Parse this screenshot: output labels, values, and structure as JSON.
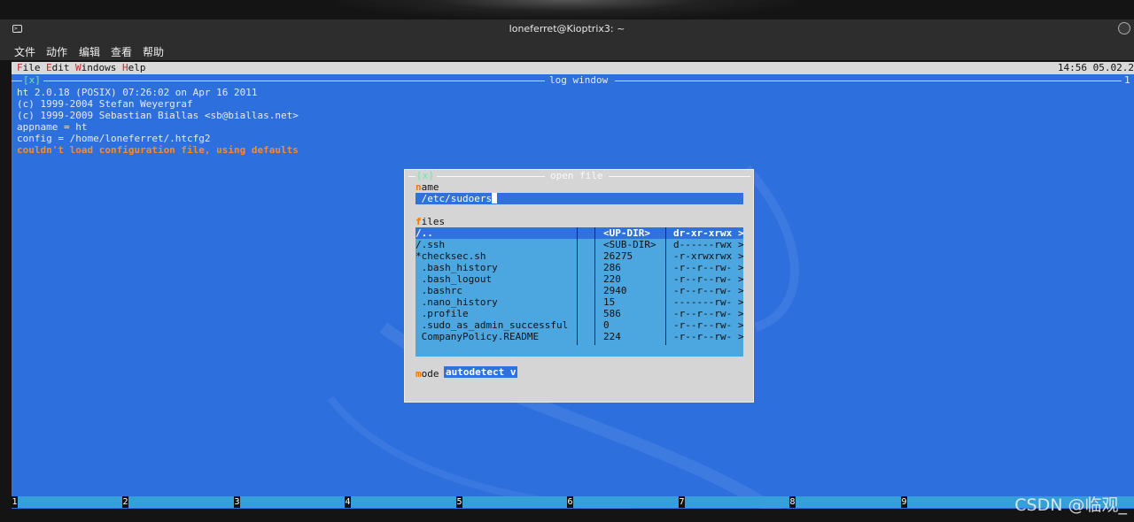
{
  "window": {
    "title": "loneferret@Kioptrix3: ~"
  },
  "app_menu": [
    "文件",
    "动作",
    "编辑",
    "查看",
    "帮助"
  ],
  "ht_menu": {
    "items": [
      {
        "hotkey": "F",
        "rest": "ile"
      },
      {
        "hotkey": "E",
        "rest": "dit"
      },
      {
        "hotkey": "W",
        "rest": "indows"
      },
      {
        "hotkey": "H",
        "rest": "elp"
      }
    ],
    "clock": "14:56 05.02.2"
  },
  "log_window": {
    "close_label": "[x]",
    "title": "log window",
    "number": "1",
    "lines": [
      "ht 2.0.18 (POSIX) 07:26:02 on Apr 16 2011",
      "(c) 1999-2004 Stefan Weyergraf",
      "(c) 1999-2009 Sebastian Biallas <sb@biallas.net>",
      "appname = ht",
      "config = /home/loneferret/.htcfg2"
    ],
    "warning": "couldn't load configuration file, using defaults"
  },
  "open_file": {
    "close_label": "[x]",
    "title": "open file",
    "name_label": {
      "hotkey": "n",
      "rest": "ame"
    },
    "name_value": " /etc/sudoers",
    "files_label": {
      "hotkey": "f",
      "rest": "iles"
    },
    "files": [
      {
        "name": "/..",
        "size": "<UP-DIR>",
        "perm": "dr-xr-xrwx",
        "more": ">"
      },
      {
        "name": "/.ssh",
        "size": "<SUB-DIR>",
        "perm": "d------rwx",
        "more": ">"
      },
      {
        "name": "*checksec.sh",
        "size": "26275",
        "perm": "-r-xrwxrwx",
        "more": ">"
      },
      {
        "name": " .bash_history",
        "size": "286",
        "perm": "-r--r--rw-",
        "more": ">"
      },
      {
        "name": " .bash_logout",
        "size": "220",
        "perm": "-r--r--rw-",
        "more": ">"
      },
      {
        "name": " .bashrc",
        "size": "2940",
        "perm": "-r--r--rw-",
        "more": ">"
      },
      {
        "name": " .nano_history",
        "size": "15",
        "perm": "-------rw-",
        "more": ">"
      },
      {
        "name": " .profile",
        "size": "586",
        "perm": "-r--r--rw-",
        "more": ">"
      },
      {
        "name": " .sudo_as_admin_successful",
        "size": "0",
        "perm": "-r--r--rw-",
        "more": ">"
      },
      {
        "name": " CompanyPolicy.README",
        "size": "224",
        "perm": "-r--r--rw-",
        "more": ">"
      }
    ],
    "mode_label": {
      "hotkey": "m",
      "rest": "ode"
    },
    "mode_value": "autodetect v"
  },
  "status_bar": {
    "numbers": [
      "1",
      "2",
      "3",
      "4",
      "5",
      "6",
      "7",
      "8",
      "9"
    ]
  },
  "watermark": "CSDN @临观_",
  "colors": {
    "terminal_bg": "#2e6fde",
    "dialog_bg": "#d5d5d5",
    "file_list_bg": "#4ca7e0",
    "hotkey": "#f07800",
    "warning": "#ff8a1f",
    "close_x": "#6fe8a6"
  }
}
